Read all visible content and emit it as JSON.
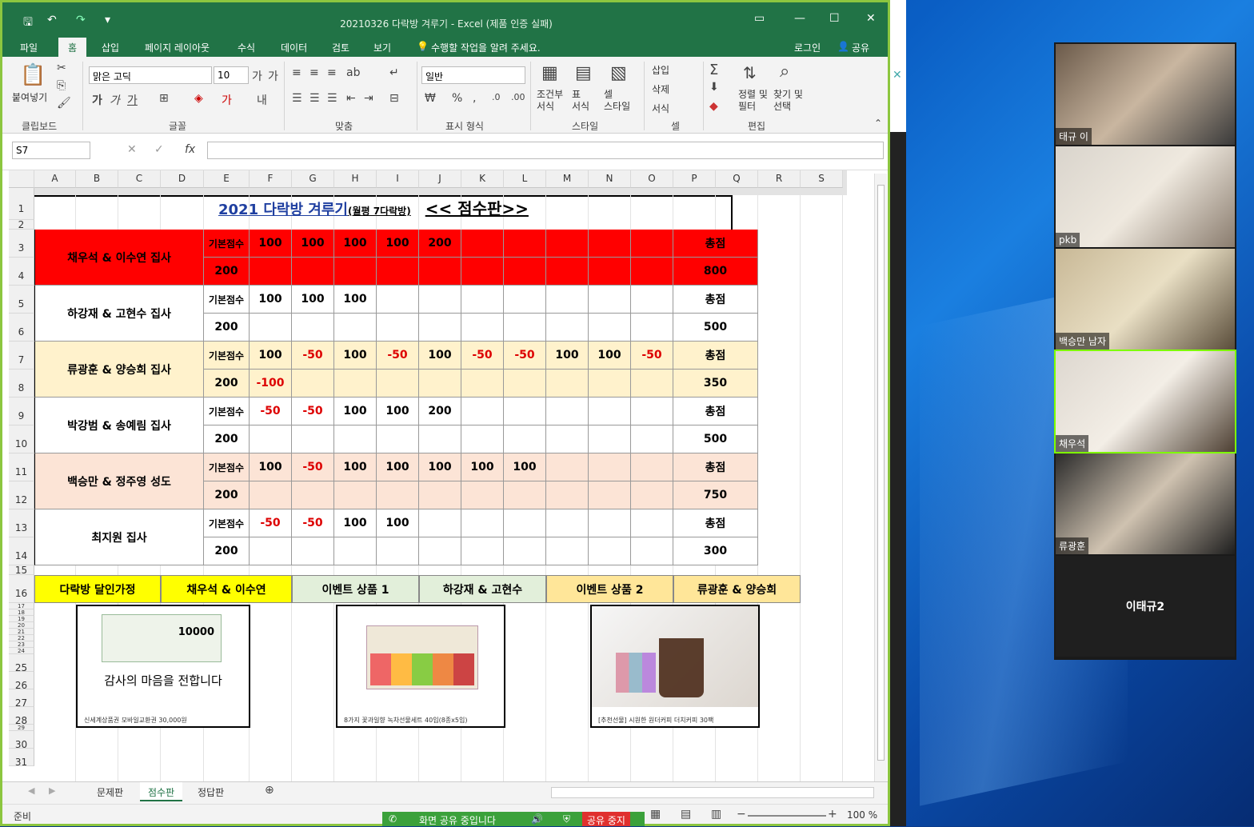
{
  "app": {
    "title": "20210326 다락방 겨루기 - Excel (제품 인증 실패)"
  },
  "menu": {
    "tabs": [
      "파일",
      "홈",
      "삽입",
      "페이지 레이아웃",
      "수식",
      "데이터",
      "검토",
      "보기"
    ],
    "tellme": "수행할 작업을 알려 주세요.",
    "login": "로그인",
    "share": "공유"
  },
  "ribbon": {
    "paste": "붙여넣기",
    "clipboard": "클립보드",
    "font_name": "맑은 고딕",
    "font_size": "10",
    "font_group": "글꼴",
    "align_group": "맞춤",
    "num_format": "일반",
    "num_group": "표시 형식",
    "cond_format": "조건부\n서식",
    "table_format": "표\n서식",
    "cell_style": "셀\n스타일",
    "style_group": "스타일",
    "insert": "삽입",
    "delete": "삭제",
    "format": "서식",
    "cell_group": "셀",
    "sort": "정렬 및\n필터",
    "find": "찾기 및\n선택",
    "edit_group": "편집"
  },
  "formula": {
    "namebox": "S7",
    "fx": "fx"
  },
  "columns": [
    "A",
    "B",
    "C",
    "D",
    "E",
    "F",
    "G",
    "H",
    "I",
    "J",
    "K",
    "L",
    "M",
    "N",
    "O",
    "P",
    "Q",
    "R",
    "S"
  ],
  "rows": [
    "1",
    "2",
    "3",
    "4",
    "5",
    "6",
    "7",
    "8",
    "9",
    "10",
    "11",
    "12",
    "13",
    "14",
    "15",
    "16",
    "17",
    "18",
    "19",
    "20",
    "21",
    "22",
    "23",
    "24",
    "25",
    "26",
    "27",
    "28",
    "29",
    "30",
    "31"
  ],
  "sheet": {
    "heading_main": "2021 다락방 겨루기",
    "heading_sub": "(월평 7다락방)",
    "heading_right": "<< 점수판>>",
    "base_label": "기본점수",
    "total_label": "총점",
    "teams": [
      {
        "name": "채우석 & 이수연 집사",
        "base": "200",
        "scores": [
          "100",
          "100",
          "100",
          "100",
          "200",
          "",
          "",
          "",
          "",
          ""
        ],
        "scores2": [
          "",
          "",
          "",
          "",
          "",
          "",
          "",
          "",
          "",
          ""
        ],
        "total": "800",
        "bg": "#ff0000"
      },
      {
        "name": "하강재 & 고현수 집사",
        "base": "200",
        "scores": [
          "100",
          "100",
          "100",
          "",
          "",
          "",
          "",
          "",
          "",
          ""
        ],
        "scores2": [
          "",
          "",
          "",
          "",
          "",
          "",
          "",
          "",
          "",
          ""
        ],
        "total": "500",
        "bg": "#ffffff"
      },
      {
        "name": "류광훈 & 양승희 집사",
        "base": "200",
        "scores": [
          "100",
          "-50",
          "100",
          "-50",
          "100",
          "-50",
          "-50",
          "100",
          "100",
          "-50"
        ],
        "scores2": [
          "-100",
          "",
          "",
          "",
          "",
          "",
          "",
          "",
          "",
          ""
        ],
        "total": "350",
        "bg": "#fff2cc"
      },
      {
        "name": "박강범 & 송예림 집사",
        "base": "200",
        "scores": [
          "-50",
          "-50",
          "100",
          "100",
          "200",
          "",
          "",
          "",
          "",
          ""
        ],
        "scores2": [
          "",
          "",
          "",
          "",
          "",
          "",
          "",
          "",
          "",
          ""
        ],
        "total": "500",
        "bg": "#ffffff"
      },
      {
        "name": "백승만 & 정주영 성도",
        "base": "200",
        "scores": [
          "100",
          "-50",
          "100",
          "100",
          "100",
          "100",
          "100",
          "",
          "",
          ""
        ],
        "scores2": [
          "",
          "",
          "",
          "",
          "",
          "",
          "",
          "",
          "",
          ""
        ],
        "total": "750",
        "bg": "#fce4d6"
      },
      {
        "name": "최지원 집사",
        "base": "200",
        "scores": [
          "-50",
          "-50",
          "100",
          "100",
          "",
          "",
          "",
          "",
          "",
          ""
        ],
        "scores2": [
          "",
          "",
          "",
          "",
          "",
          "",
          "",
          "",
          "",
          ""
        ],
        "total": "300",
        "bg": "#ffffff"
      }
    ],
    "prizes": [
      {
        "label": "다락방 달인가정",
        "winner": "채우석 & 이수연",
        "bg": "#ffff00"
      },
      {
        "label": "이벤트 상품 1",
        "winner": "하강재 & 고현수",
        "bg": "#e2efda"
      },
      {
        "label": "이벤트 상품 2",
        "winner": "류광훈 & 양승희",
        "bg": "#ffe699"
      }
    ],
    "prize_captions": [
      "신세계상품권 모바일교환권 30,000원",
      "8가지 꽃과일향 녹차선물세트 40입(8종x5입)",
      "[추천선물] 시원한 원더커피 더치커피 30팩"
    ],
    "voucher_text": "감사의 마음을 전합니다",
    "voucher_amount": "10000"
  },
  "sheets": [
    "문제판",
    "점수판",
    "정답판"
  ],
  "status": {
    "ready": "준비",
    "zoom": "100 %"
  },
  "zoom_panel": {
    "participants": [
      "태규 이",
      "pkb",
      "백승만 남자",
      "채우석",
      "류광훈"
    ],
    "self_name": "이태규2"
  },
  "screenshare": {
    "text": "화면 공유 중입니다",
    "stop": "공유 중지"
  }
}
